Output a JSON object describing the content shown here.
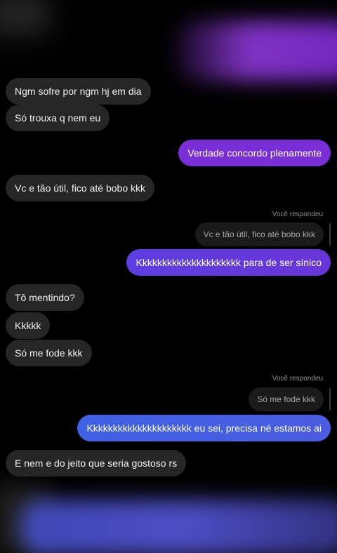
{
  "messages": {
    "m1": "Ngm sofre por ngm hj em dia",
    "m2": "Só trouxa q nem eu",
    "m3": "Verdade concordo plenamente",
    "m4": "Vc e tão útil, fico até bobo kkk",
    "reply1_label": "Você respondeu",
    "reply1_quote": "Vc e tão útil, fico até bobo kkk",
    "m5": "Kkkkkkkkkkkkkkkkkkkkk para de ser sínico",
    "m6": "Tô mentindo?",
    "m7": "Kkkkk",
    "m8": "Só me fode kkk",
    "reply2_label": "Você respondeu",
    "reply2_quote": "Só me fode kkk",
    "m9": "Kkkkkkkkkkkkkkkkkkkkk eu sei, precisa né estamos ai",
    "m10": "E nem e do jeito que seria gostoso rs"
  },
  "colors": {
    "incoming_bubble": "#262626",
    "out_bubble_1": "#7a2fd6",
    "out_bubble_2": "#6a35d8",
    "out_bubble_3": "#4a5ce0",
    "background": "#000000"
  }
}
